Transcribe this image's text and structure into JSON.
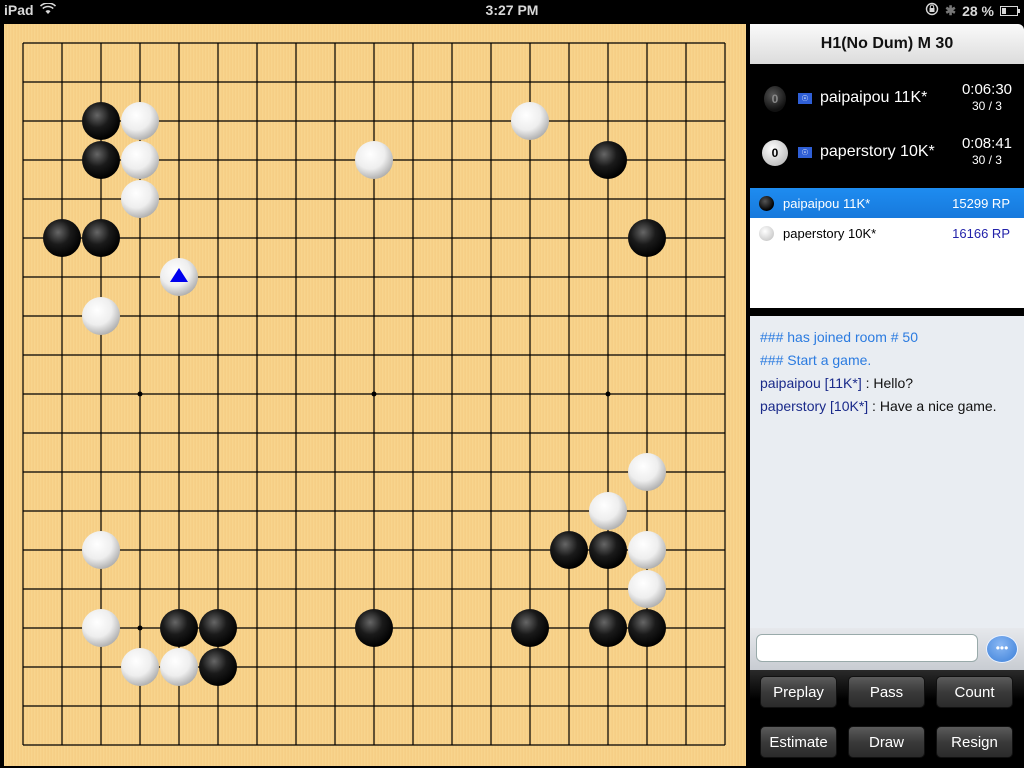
{
  "status_bar": {
    "device": "iPad",
    "time": "3:27 PM",
    "battery_percent_label": "28 %",
    "battery_level": 0.28,
    "icons": [
      "wifi-icon",
      "rotation-lock-icon",
      "bluetooth-icon",
      "battery-icon"
    ]
  },
  "board": {
    "size": 19,
    "star_points": [
      [
        3,
        3
      ],
      [
        3,
        9
      ],
      [
        3,
        15
      ],
      [
        9,
        3
      ],
      [
        9,
        9
      ],
      [
        9,
        15
      ],
      [
        15,
        3
      ],
      [
        15,
        9
      ],
      [
        15,
        15
      ]
    ],
    "stones": [
      {
        "col": 2,
        "row": 2,
        "color": "black"
      },
      {
        "col": 3,
        "row": 2,
        "color": "white"
      },
      {
        "col": 13,
        "row": 2,
        "color": "white"
      },
      {
        "col": 2,
        "row": 3,
        "color": "black"
      },
      {
        "col": 3,
        "row": 3,
        "color": "white"
      },
      {
        "col": 9,
        "row": 3,
        "color": "white"
      },
      {
        "col": 15,
        "row": 3,
        "color": "black"
      },
      {
        "col": 3,
        "row": 4,
        "color": "white"
      },
      {
        "col": 1,
        "row": 5,
        "color": "black"
      },
      {
        "col": 2,
        "row": 5,
        "color": "black"
      },
      {
        "col": 16,
        "row": 5,
        "color": "black"
      },
      {
        "col": 4,
        "row": 6,
        "color": "white",
        "last_move": true
      },
      {
        "col": 2,
        "row": 7,
        "color": "white"
      },
      {
        "col": 16,
        "row": 11,
        "color": "white"
      },
      {
        "col": 15,
        "row": 12,
        "color": "white"
      },
      {
        "col": 2,
        "row": 13,
        "color": "white"
      },
      {
        "col": 14,
        "row": 13,
        "color": "black"
      },
      {
        "col": 15,
        "row": 13,
        "color": "black"
      },
      {
        "col": 16,
        "row": 13,
        "color": "white"
      },
      {
        "col": 16,
        "row": 14,
        "color": "white"
      },
      {
        "col": 2,
        "row": 15,
        "color": "white"
      },
      {
        "col": 4,
        "row": 15,
        "color": "black"
      },
      {
        "col": 5,
        "row": 15,
        "color": "black"
      },
      {
        "col": 9,
        "row": 15,
        "color": "black"
      },
      {
        "col": 13,
        "row": 15,
        "color": "black"
      },
      {
        "col": 15,
        "row": 15,
        "color": "black"
      },
      {
        "col": 16,
        "row": 15,
        "color": "black"
      },
      {
        "col": 3,
        "row": 16,
        "color": "white"
      },
      {
        "col": 4,
        "row": 16,
        "color": "white"
      },
      {
        "col": 5,
        "row": 16,
        "color": "black"
      }
    ],
    "last_move_marker_color": "#0000ee"
  },
  "panel": {
    "title": "H1(No Dum) M 30",
    "players": [
      {
        "color": "black",
        "captures": "0",
        "name": "paipaipou 11K*",
        "time": "0:06:30",
        "byoyomi": "30 / 3",
        "flag": "un-flag-icon"
      },
      {
        "color": "white",
        "captures": "0",
        "name": "paperstory 10K*",
        "time": "0:08:41",
        "byoyomi": "30 / 3",
        "flag": "un-flag-icon"
      }
    ],
    "rank_list": [
      {
        "color": "black",
        "name": "paipaipou 11K*",
        "rp": "15299 RP",
        "selected": true
      },
      {
        "color": "white",
        "name": "paperstory 10K*",
        "rp": "16166 RP",
        "selected": false
      }
    ]
  },
  "chat": {
    "lines": [
      {
        "type": "system",
        "who": "",
        "text": "### has joined room # 50"
      },
      {
        "type": "system",
        "who": "",
        "text": "### Start a game."
      },
      {
        "type": "user",
        "who": "paipaipou [11K*]",
        "text": " : Hello?"
      },
      {
        "type": "user",
        "who": "paperstory [10K*]",
        "text": " : Have a nice game."
      }
    ],
    "input_value": "",
    "input_placeholder": "",
    "send_icon": "speech-bubble-icon"
  },
  "buttons": {
    "preplay": "Preplay",
    "pass": "Pass",
    "count": "Count",
    "estimate": "Estimate",
    "draw": "Draw",
    "resign": "Resign"
  },
  "colors": {
    "board_wood": "#f8d48e",
    "selection_blue": "#1e8cf0",
    "system_text": "#2b7be0",
    "user_text": "#1a2a8a",
    "rp_text": "#2222aa"
  }
}
